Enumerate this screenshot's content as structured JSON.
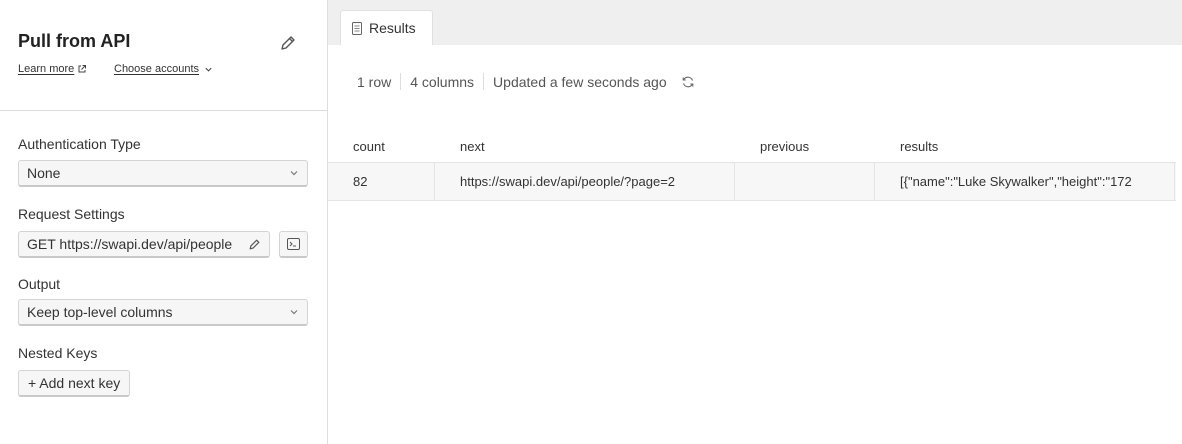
{
  "left": {
    "title": "Pull from API",
    "learn_more": "Learn more",
    "choose_accounts": "Choose accounts",
    "auth": {
      "label": "Authentication Type",
      "value": "None"
    },
    "request": {
      "label": "Request Settings",
      "value": "GET https://swapi.dev/api/people"
    },
    "output": {
      "label": "Output",
      "value": "Keep top-level columns"
    },
    "nested": {
      "label": "Nested Keys",
      "add_label": "+ Add next key"
    }
  },
  "right": {
    "tab_label": "Results",
    "meta": {
      "rows": "1 row",
      "columns": "4 columns",
      "updated": "Updated a few seconds ago"
    },
    "table": {
      "headers": [
        "count",
        "next",
        "previous",
        "results"
      ],
      "rows": [
        [
          "82",
          "https://swapi.dev/api/people/?page=2",
          "",
          "[{\"name\":\"Luke Skywalker\",\"height\":\"172"
        ]
      ]
    }
  },
  "icons": {
    "edit": "pencil-icon",
    "external": "external-link-icon",
    "chevron": "chevron-down-icon",
    "terminal": "terminal-icon",
    "tab": "document-icon",
    "refresh": "refresh-icon"
  }
}
